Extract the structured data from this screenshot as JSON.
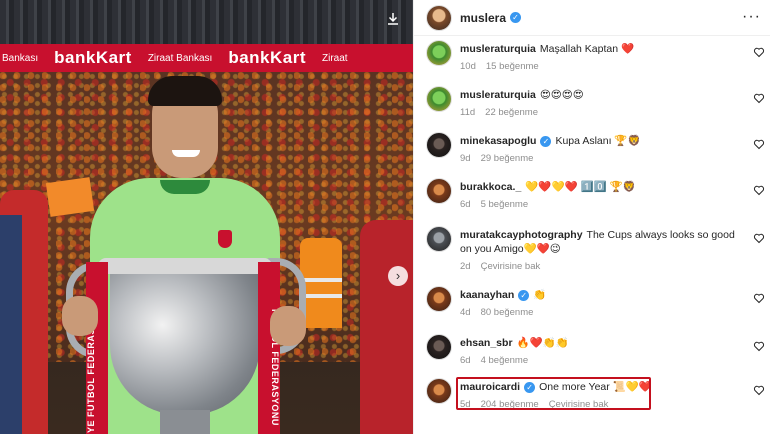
{
  "banner": {
    "items": [
      "Bankası",
      "bankKart",
      "Ziraat Bankası",
      "bankKart",
      "Ziraat"
    ]
  },
  "photo": {
    "ribbon_text": "FUTBOL FEDERASYONU",
    "ribbon_text_left": "YE FUTBOL FEDERASYONU"
  },
  "post": {
    "username": "muslera"
  },
  "comments": [
    {
      "user": "muslerаturquia",
      "text": "Maşallah Kaptan ❤️",
      "time": "10d",
      "likes": "15 beğenme",
      "extra": "",
      "avatar": "green",
      "verified": false
    },
    {
      "user": "muslerаturquia",
      "text": "😍😍😍😍",
      "time": "11d",
      "likes": "22 beğenme",
      "extra": "",
      "avatar": "green",
      "verified": false
    },
    {
      "user": "minekasapoglu",
      "text": "Kupa Aslanı 🏆🦁",
      "time": "9d",
      "likes": "29 beğenme",
      "extra": "",
      "avatar": "dark",
      "verified": true
    },
    {
      "user": "burakkoca._",
      "text": "💛❤️💛❤️ 1️⃣0️⃣ 🏆🦁",
      "time": "6d",
      "likes": "5 beğenme",
      "extra": "",
      "avatar": "warm",
      "verified": false
    },
    {
      "user": "muratakcayphotography",
      "text": "The Cups always looks so good on you Amigo💛❤️😉",
      "time": "2d",
      "likes": "",
      "extra": "Çevirisine bak",
      "avatar": "gray",
      "verified": false
    },
    {
      "user": "kaanayhan",
      "text": "👏",
      "time": "4d",
      "likes": "80 beğenme",
      "extra": "",
      "avatar": "warm",
      "verified": true
    },
    {
      "user": "ehsan_sbr",
      "text": "🔥❤️👏👏",
      "time": "6d",
      "likes": "4 beğenme",
      "extra": "",
      "avatar": "dark",
      "verified": false
    },
    {
      "user": "mauroicardi",
      "text": "One more Year 📜💛❤️",
      "time": "5d",
      "likes": "204 beğenme",
      "extra": "Çevirisine bak",
      "avatar": "warm",
      "verified": true
    }
  ],
  "icons": {
    "more": "more-options-icon",
    "heart": "heart-outline-icon",
    "download": "download-icon",
    "next": "chevron-right-icon",
    "verified": "verified-badge-icon"
  },
  "colors": {
    "highlight": "#c4101e",
    "verified": "#3897f0",
    "banner": "#c8102e"
  }
}
